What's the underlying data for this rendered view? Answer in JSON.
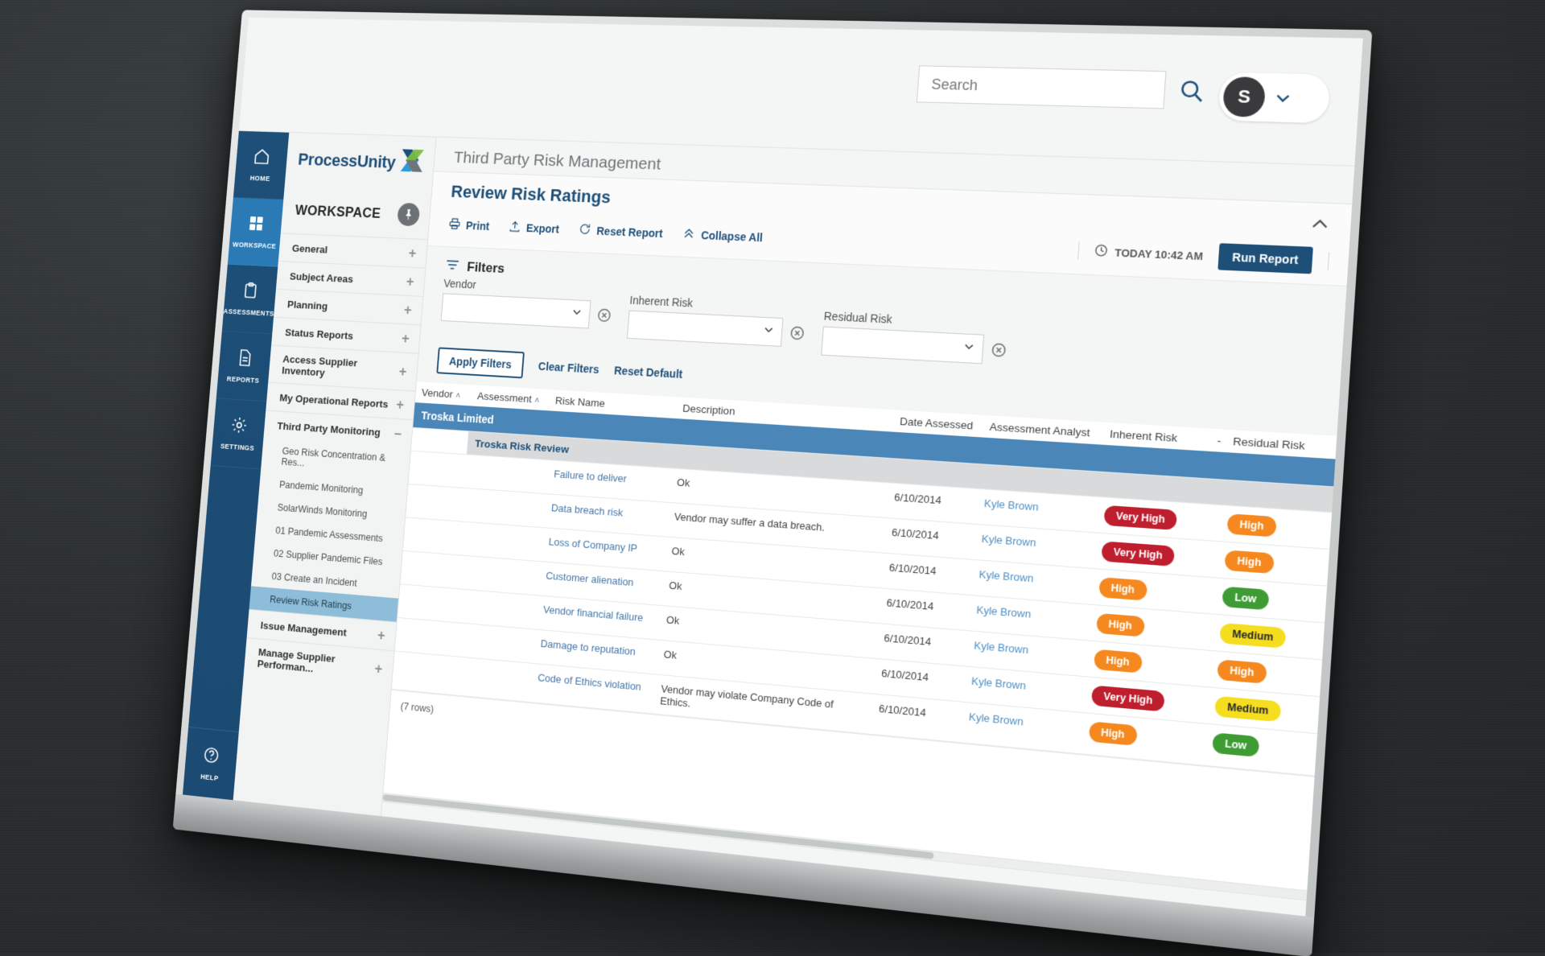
{
  "window": {
    "app_title": "Third Party Risk Management"
  },
  "topbar": {
    "search_placeholder": "Search",
    "search_value": "",
    "search_icon": "search-icon",
    "avatar_initial": "S",
    "chevron_icon": "chevron-down-icon"
  },
  "rail": {
    "items": [
      {
        "label": "HOME",
        "icon": "home-icon",
        "active": false
      },
      {
        "label": "WORKSPACE",
        "icon": "grid-icon",
        "active": true
      },
      {
        "label": "ASSESSMENTS",
        "icon": "clipboard-icon",
        "active": false
      },
      {
        "label": "REPORTS",
        "icon": "document-icon",
        "active": false
      },
      {
        "label": "SETTINGS",
        "icon": "gear-icon",
        "active": false
      }
    ],
    "help": {
      "label": "HELP",
      "icon": "help-icon"
    }
  },
  "nav": {
    "brand": "ProcessUnity",
    "header": "WORKSPACE",
    "pin_icon": "pin-icon",
    "items": [
      {
        "label": "General",
        "toggle": "+"
      },
      {
        "label": "Subject Areas",
        "toggle": "+"
      },
      {
        "label": "Planning",
        "toggle": "+"
      },
      {
        "label": "Status Reports",
        "toggle": "+"
      },
      {
        "label": "Access Supplier Inventory",
        "toggle": "+"
      },
      {
        "label": "My Operational Reports",
        "toggle": "+"
      },
      {
        "label": "Third Party Monitoring",
        "toggle": "–"
      }
    ],
    "sub_items": [
      {
        "label": "Geo Risk Concentration & Res...",
        "selected": false
      },
      {
        "label": "Pandemic Monitoring",
        "selected": false
      },
      {
        "label": "SolarWinds Monitoring",
        "selected": false
      },
      {
        "label": "01 Pandemic Assessments",
        "selected": false
      },
      {
        "label": "02 Supplier Pandemic Files",
        "selected": false
      },
      {
        "label": "03 Create an Incident",
        "selected": false
      },
      {
        "label": "Review Risk Ratings",
        "selected": true
      }
    ],
    "items_after": [
      {
        "label": "Issue Management",
        "toggle": "+"
      },
      {
        "label": "Manage Supplier Performan...",
        "toggle": "+"
      }
    ]
  },
  "report": {
    "title": "Review Risk Ratings",
    "collapse_icon": "chevron-up-icon",
    "toolbar": {
      "print": "Print",
      "print_icon": "printer-icon",
      "export": "Export",
      "export_icon": "upload-icon",
      "reset_report": "Reset Report",
      "reset_icon": "refresh-icon",
      "collapse_all": "Collapse All",
      "collapse_all_icon": "chevron-double-up-icon",
      "timestamp": "TODAY 10:42 AM",
      "clock_icon": "clock-icon",
      "run_report": "Run Report"
    },
    "filters": {
      "heading": "Filters",
      "filter_icon": "filter-icon",
      "fields": [
        {
          "label": "Vendor",
          "value": "",
          "clear_icon": "clear-circle-icon"
        },
        {
          "label": "Inherent Risk",
          "value": "",
          "clear_icon": "clear-circle-icon"
        },
        {
          "label": "Residual Risk",
          "value": "",
          "clear_icon": "clear-circle-icon"
        }
      ],
      "apply": "Apply Filters",
      "clear": "Clear Filters",
      "reset_default": "Reset Default"
    }
  },
  "table": {
    "columns": [
      "Vendor",
      "Assessment",
      "Risk Name",
      "Description",
      "Date Assessed",
      "Assessment Analyst",
      "Inherent Risk",
      "-",
      "Residual Risk"
    ],
    "sort_indicator": "˄",
    "group_banner": "Troska Limited",
    "group_sub": "Troska Risk Review",
    "rows": [
      {
        "risk_name": "Failure to deliver",
        "description": "Ok",
        "date": "6/10/2014",
        "analyst": "Kyle Brown",
        "inherent": "Very High",
        "inherent_level": "veryhigh",
        "residual": "High",
        "residual_level": "high"
      },
      {
        "risk_name": "Data breach risk",
        "description": "Vendor may suffer a data breach.",
        "date": "6/10/2014",
        "analyst": "Kyle Brown",
        "inherent": "Very High",
        "inherent_level": "veryhigh",
        "residual": "High",
        "residual_level": "high"
      },
      {
        "risk_name": "Loss of Company IP",
        "description": "Ok",
        "date": "6/10/2014",
        "analyst": "Kyle Brown",
        "inherent": "High",
        "inherent_level": "high",
        "residual": "Low",
        "residual_level": "low"
      },
      {
        "risk_name": "Customer alienation",
        "description": "Ok",
        "date": "6/10/2014",
        "analyst": "Kyle Brown",
        "inherent": "High",
        "inherent_level": "high",
        "residual": "Medium",
        "residual_level": "medium"
      },
      {
        "risk_name": "Vendor financial failure",
        "description": "Ok",
        "date": "6/10/2014",
        "analyst": "Kyle Brown",
        "inherent": "High",
        "inherent_level": "high",
        "residual": "High",
        "residual_level": "high"
      },
      {
        "risk_name": "Damage to reputation",
        "description": "Ok",
        "date": "6/10/2014",
        "analyst": "Kyle Brown",
        "inherent": "Very High",
        "inherent_level": "veryhigh",
        "residual": "Medium",
        "residual_level": "medium"
      },
      {
        "risk_name": "Code of Ethics violation",
        "description": "Vendor may violate Company Code of Ethics.",
        "date": "6/10/2014",
        "analyst": "Kyle Brown",
        "inherent": "High",
        "inherent_level": "high",
        "residual": "Low",
        "residual_level": "low"
      }
    ],
    "row_count": "(7 rows)"
  },
  "colors": {
    "brand_blue": "#1d4f78",
    "accent_blue": "#2a7ab5",
    "banner_blue": "#4a87b8",
    "very_high": "#be1e2d",
    "high": "#f5891f",
    "medium": "#f5dd1f",
    "low": "#3f9c35"
  }
}
